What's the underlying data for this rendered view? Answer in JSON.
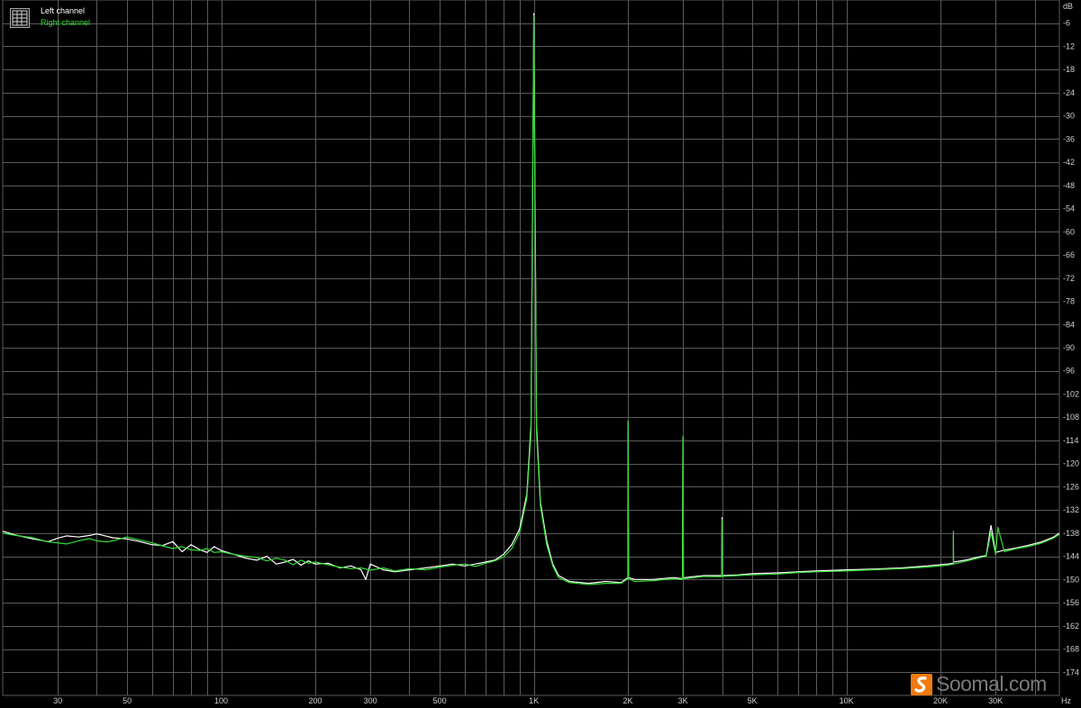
{
  "chart_data": {
    "type": "line",
    "xscale": "log",
    "xlim": [
      20,
      48000
    ],
    "ylim": [
      -180,
      0
    ],
    "xunit": "Hz",
    "yunit": "dB",
    "grid": true,
    "legend_position": "top-left",
    "background_color": "#000000",
    "grid_color": "#5a5a5a",
    "x_ticks": [
      {
        "value": 30,
        "label": "30"
      },
      {
        "value": 50,
        "label": "50"
      },
      {
        "value": 100,
        "label": "100"
      },
      {
        "value": 200,
        "label": "200"
      },
      {
        "value": 300,
        "label": "300"
      },
      {
        "value": 500,
        "label": "500"
      },
      {
        "value": 1000,
        "label": "1K"
      },
      {
        "value": 2000,
        "label": "2K"
      },
      {
        "value": 3000,
        "label": "3K"
      },
      {
        "value": 5000,
        "label": "5K"
      },
      {
        "value": 10000,
        "label": "10K"
      },
      {
        "value": 20000,
        "label": "20K"
      },
      {
        "value": 30000,
        "label": "30K"
      }
    ],
    "y_ticks": [
      -6,
      -12,
      -18,
      -24,
      -30,
      -36,
      -42,
      -48,
      -54,
      -60,
      -66,
      -72,
      -78,
      -84,
      -90,
      -96,
      -102,
      -108,
      -114,
      -120,
      -126,
      -132,
      -138,
      -144,
      -150,
      -156,
      -162,
      -168,
      -174
    ],
    "series": [
      {
        "name": "Left channel",
        "color": "#ffffff",
        "x": [
          20,
          22,
          25,
          28,
          30,
          32,
          35,
          38,
          40,
          43,
          45,
          50,
          55,
          60,
          65,
          70,
          75,
          80,
          85,
          90,
          95,
          100,
          110,
          120,
          130,
          140,
          150,
          160,
          170,
          180,
          190,
          200,
          220,
          240,
          260,
          280,
          290,
          300,
          330,
          360,
          400,
          450,
          500,
          550,
          600,
          650,
          700,
          750,
          800,
          850,
          900,
          950,
          980,
          1000,
          1020,
          1050,
          1100,
          1150,
          1200,
          1300,
          1500,
          1700,
          1900,
          2000,
          2001,
          2010,
          2100,
          2400,
          2800,
          2990,
          3000,
          3010,
          3200,
          3500,
          3990,
          4000,
          4010,
          4500,
          5000,
          6000,
          7000,
          8000,
          10000,
          12000,
          15000,
          18000,
          21000,
          21990,
          22000,
          22010,
          24000,
          26000,
          28000,
          29000,
          30000,
          32000,
          35000,
          38000,
          42000,
          46000,
          48000
        ],
        "y": [
          -137.5,
          -138.5,
          -139.5,
          -140.2,
          -139.3,
          -138.7,
          -139.0,
          -138.6,
          -138.2,
          -138.8,
          -139.2,
          -139.5,
          -140.2,
          -141.0,
          -141.2,
          -140.2,
          -142.8,
          -141.0,
          -142.2,
          -143.0,
          -141.5,
          -142.5,
          -143.5,
          -144.5,
          -145.0,
          -144.0,
          -146.0,
          -145.5,
          -144.8,
          -146.3,
          -145.2,
          -146.0,
          -145.8,
          -147.0,
          -146.5,
          -147.5,
          -150.0,
          -146.0,
          -147.5,
          -148.0,
          -147.5,
          -147.0,
          -146.5,
          -146.0,
          -146.5,
          -146.0,
          -145.5,
          -145.0,
          -143.5,
          -141.0,
          -137.0,
          -128.0,
          -110.0,
          -3.5,
          -110.0,
          -130.0,
          -140.0,
          -146.0,
          -149.0,
          -150.5,
          -151.0,
          -150.5,
          -150.8,
          -149.5,
          -109.5,
          -149.5,
          -150.0,
          -150.0,
          -149.5,
          -149.8,
          -113.5,
          -149.6,
          -149.3,
          -149.0,
          -149.0,
          -134.0,
          -149.0,
          -148.8,
          -148.5,
          -148.3,
          -148.0,
          -147.8,
          -147.5,
          -147.3,
          -147.0,
          -146.5,
          -146.0,
          -145.8,
          -138.5,
          -145.5,
          -145.0,
          -144.3,
          -143.8,
          -136.0,
          -143.0,
          -142.4,
          -141.8,
          -141.2,
          -140.3,
          -139.0,
          -138.0
        ]
      },
      {
        "name": "Right channel",
        "color": "#33dd33",
        "x": [
          20,
          22,
          25,
          28,
          30,
          32,
          35,
          38,
          40,
          43,
          45,
          50,
          55,
          60,
          65,
          70,
          75,
          80,
          85,
          90,
          95,
          100,
          110,
          120,
          130,
          140,
          150,
          160,
          170,
          180,
          190,
          200,
          220,
          240,
          260,
          280,
          300,
          330,
          360,
          400,
          450,
          500,
          550,
          600,
          650,
          700,
          750,
          800,
          850,
          900,
          950,
          980,
          1000,
          1020,
          1050,
          1100,
          1150,
          1200,
          1300,
          1500,
          1700,
          1900,
          2000,
          2001,
          2010,
          2100,
          2400,
          2800,
          2990,
          3000,
          3010,
          3200,
          3500,
          3990,
          4000,
          4010,
          4500,
          5000,
          6000,
          7000,
          8000,
          10000,
          12000,
          15000,
          18000,
          21000,
          21990,
          22000,
          22010,
          24000,
          26000,
          28000,
          29000,
          30000,
          30500,
          32000,
          35000,
          38000,
          42000,
          46000,
          48000
        ],
        "y": [
          -138.0,
          -138.6,
          -139.2,
          -140.3,
          -140.5,
          -140.8,
          -140.0,
          -139.4,
          -140.0,
          -140.3,
          -140.0,
          -139.0,
          -139.8,
          -140.5,
          -141.3,
          -142.0,
          -141.5,
          -142.3,
          -142.5,
          -142.0,
          -143.0,
          -142.8,
          -143.5,
          -144.0,
          -144.3,
          -145.2,
          -144.5,
          -145.0,
          -146.2,
          -145.0,
          -145.8,
          -145.5,
          -146.2,
          -146.8,
          -147.2,
          -147.0,
          -147.6,
          -147.0,
          -147.8,
          -147.2,
          -147.5,
          -146.8,
          -146.3,
          -146.0,
          -146.6,
          -145.8,
          -145.2,
          -144.2,
          -142.0,
          -138.0,
          -129.0,
          -112.0,
          -4.0,
          -112.0,
          -131.0,
          -141.0,
          -146.5,
          -149.5,
          -150.8,
          -151.3,
          -151.0,
          -151.0,
          -149.8,
          -109.0,
          -149.8,
          -150.5,
          -150.3,
          -149.8,
          -150.0,
          -113.0,
          -149.8,
          -149.6,
          -149.2,
          -149.3,
          -134.5,
          -149.2,
          -149.0,
          -148.8,
          -148.6,
          -148.2,
          -148.0,
          -147.8,
          -147.5,
          -147.2,
          -146.8,
          -146.3,
          -146.0,
          -137.5,
          -146.0,
          -145.3,
          -144.6,
          -144.0,
          -137.8,
          -143.5,
          -136.5,
          -142.8,
          -142.0,
          -141.5,
          -140.6,
          -139.3,
          -138.3
        ]
      }
    ]
  },
  "watermark": {
    "text": "Soomal.com",
    "logo_color": "#f07a10"
  }
}
